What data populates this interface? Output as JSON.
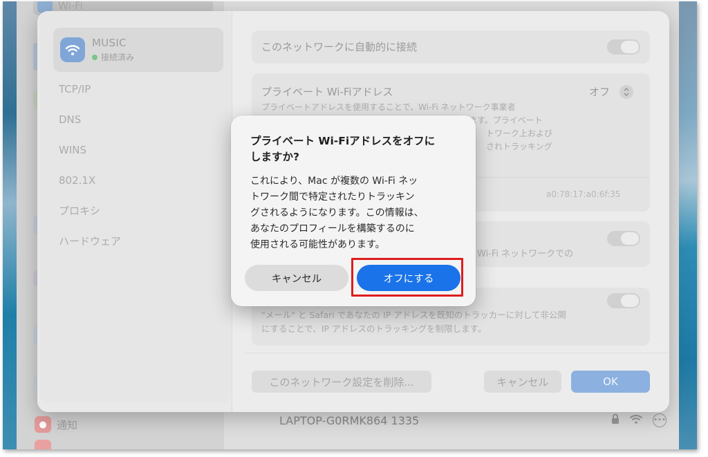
{
  "colors": {
    "accent_blue": "#1a73e8",
    "highlight_red": "#e01c1c",
    "status_green": "#79c58a"
  },
  "background_window": {
    "sidebar_top_item": "Wi-Fi",
    "notifications_label": "通知",
    "network_row_name": "LAPTOP-G0RMK864 1335"
  },
  "network_sheet": {
    "network_name": "MUSIC",
    "network_status": "接続済み",
    "sidebar_items": [
      "TCP/IP",
      "DNS",
      "WINS",
      "802.1X",
      "プロキシ",
      "ハードウェア"
    ],
    "auto_join_label": "このネットワークに自動的に接続",
    "private_address_label": "プライベート Wi-Fiアドレス",
    "private_address_value": "オフ",
    "private_address_desc_lines": [
      "プライベートアドレスを使用することで、Wi-Fi ネットワーク事業者",
      "ます。プライベート",
      "トワーク上および",
      "されトラッキング"
    ],
    "mac_address_value": "a0:78:17:a0:6f:35",
    "low_data_desc_fragment": "Wi-Fi ネットワークでの",
    "limit_ip_desc_lines": [
      "\"メール\" と Safari であなたの IP アドレスを既知のトラッカーに対して非公開",
      "にすることで、IP アドレスのトラッキングを制限します。"
    ],
    "forget_button": "このネットワーク設定を削除...",
    "cancel_button": "キャンセル",
    "ok_button": "OK"
  },
  "dialog": {
    "title_lines": [
      "プライベート Wi-Fiアドレスをオフに",
      "しますか?"
    ],
    "body_lines": [
      "これにより、Mac が複数の Wi-Fi ネッ",
      "トワーク間で特定されたりトラッキン",
      "グされるようになります。この情報は、",
      "あなたのプロフィールを構築するのに",
      "使用される可能性があります。"
    ],
    "cancel_label": "キャンセル",
    "confirm_label": "オフにする"
  },
  "icons": {
    "wifi": "wifi-icon",
    "chevron_updown": "chevron-updown-icon",
    "lock": "lock-icon",
    "more": "more-icon",
    "bell": "bell-icon"
  }
}
